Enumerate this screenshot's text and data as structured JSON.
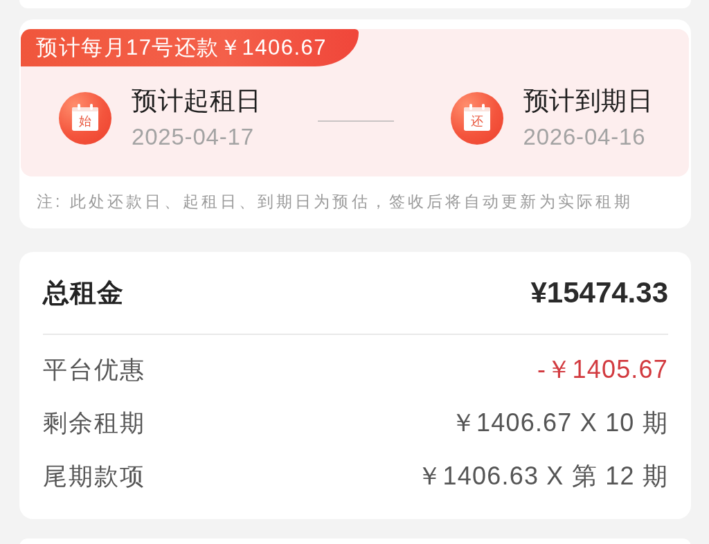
{
  "repayment_card": {
    "banner": "预计每月17号还款￥1406.67",
    "dates": [
      {
        "badge": "始",
        "title": "预计起租日",
        "date": "2025-04-17"
      },
      {
        "badge": "还",
        "title": "预计到期日",
        "date": "2026-04-16"
      }
    ],
    "note": "注: 此处还款日、起租日、到期日为预估，签收后将自动更新为实际租期"
  },
  "rent_card": {
    "total": {
      "label": "总租金",
      "value": "¥15474.33"
    },
    "items": [
      {
        "kind": "discount",
        "label": "平台优惠",
        "value": "-￥1405.67"
      },
      {
        "kind": "charge",
        "label": "剩余租期",
        "value": "￥1406.67 X 10 期"
      },
      {
        "kind": "charge",
        "label": "尾期款项",
        "value": "￥1406.63 X 第 12 期"
      }
    ]
  }
}
